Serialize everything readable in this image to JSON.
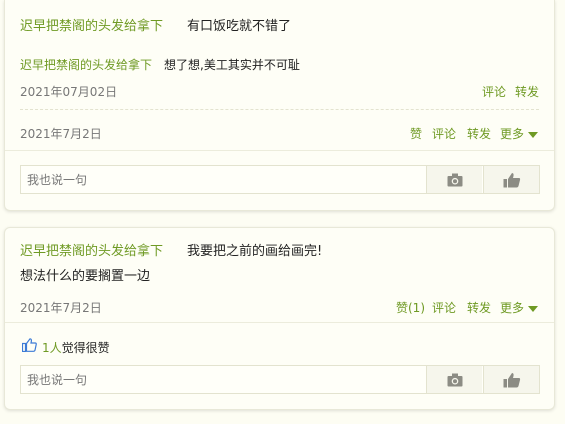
{
  "comments": [
    {
      "author": "迟早把禁阁的头发给拿下",
      "text": "有口饭吃就不错了",
      "reply": {
        "author": "迟早把禁阁的头发给拿下",
        "text": "想了想,美工其实并不可耻",
        "date": "2021年07月02日",
        "comment_label": "评论",
        "forward_label": "转发"
      },
      "date": "2021年7月2日",
      "actions": {
        "like": "赞",
        "comment": "评论",
        "forward": "转发",
        "more": "更多"
      },
      "reply_placeholder": "我也说一句"
    },
    {
      "author": "迟早把禁阁的头发给拿下",
      "text": "我要把之前的画给画完!",
      "text_line2": "想法什么的要搁置一边",
      "date": "2021年7月2日",
      "actions": {
        "like": "赞(1)",
        "comment": "评论",
        "forward": "转发",
        "more": "更多"
      },
      "likes": {
        "count": "1人",
        "suffix": "觉得很赞"
      },
      "reply_placeholder": "我也说一句"
    }
  ],
  "icons": {
    "camera": "camera-icon",
    "thumb": "thumbs-up-icon",
    "like": "like-icon",
    "more": "triangle-down-icon"
  },
  "colors": {
    "accent": "#6f9a24",
    "background": "#fdfdf3"
  }
}
